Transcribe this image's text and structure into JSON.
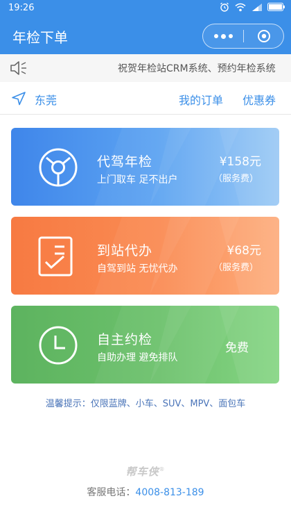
{
  "status_bar": {
    "time": "19:26"
  },
  "navbar": {
    "title": "年检下单"
  },
  "notice": {
    "text": "祝贺年检站CRM系统、预约年检系统"
  },
  "location_bar": {
    "city": "东莞",
    "my_orders": "我的订单",
    "coupons": "优惠券"
  },
  "services": [
    {
      "title": "代驾年检",
      "subtitle": "上门取车 足不出户",
      "price": "¥158元",
      "fee_note": "（服务费）",
      "icon": "steering-wheel-icon",
      "color": "#4a8fec"
    },
    {
      "title": "到站代办",
      "subtitle": "自驾到站 无忧代办",
      "price": "¥68元",
      "fee_note": "（服务费）",
      "icon": "checklist-icon",
      "color": "#f8834b"
    },
    {
      "title": "自主约检",
      "subtitle": "自助办理 避免排队",
      "price": "免费",
      "icon": "clock-icon",
      "color": "#64ba65"
    }
  ],
  "tip": {
    "label": "温馨提示：",
    "text": "仅限蓝牌、小车、SUV、MPV、面包车"
  },
  "footer": {
    "brand": "帮车侠",
    "registered": "®",
    "service_label": "客服电话：",
    "phone": "4008-813-189"
  }
}
